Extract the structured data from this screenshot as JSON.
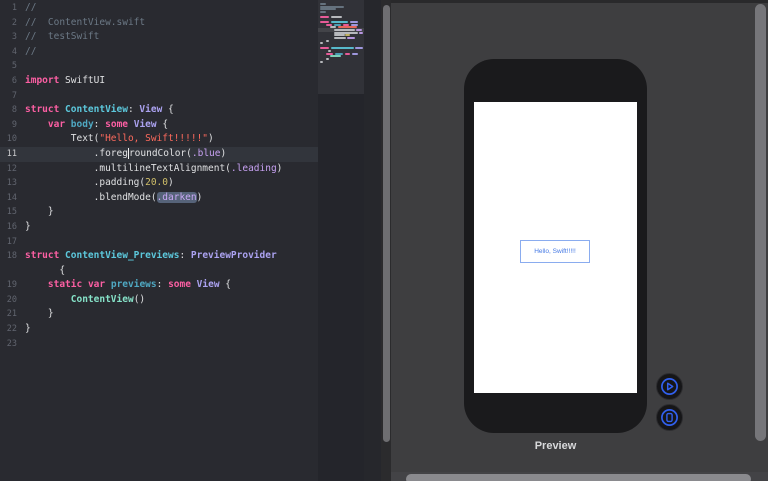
{
  "colors": {
    "editor_bg": "#292A30",
    "canvas_bg": "#3E3E40",
    "line_highlight": "#32353C",
    "selection_bg": "#566379",
    "keyword": "#FC5FA3",
    "string": "#FC6A5D",
    "number": "#D0BF69",
    "comment": "#6C7986",
    "plain": "#DFE0E2",
    "type_declaration": "#5CC8DC",
    "type_reference": "#ABA2F0",
    "property_declaration": "#4FA8C2",
    "member_reference": "#C7A1F2",
    "project_type": "#86E2C8",
    "accent_blue": "#3160EE",
    "preview_text_blue": "#4579E4",
    "preview_box_border": "#8AACEF"
  },
  "editor": {
    "current_line": "11",
    "lines": [
      {
        "n": "1",
        "seg": [
          [
            "cm",
            "//"
          ]
        ]
      },
      {
        "n": "2",
        "seg": [
          [
            "cm",
            "//  ContentView.swift"
          ]
        ]
      },
      {
        "n": "3",
        "seg": [
          [
            "cm",
            "//  testSwift"
          ]
        ]
      },
      {
        "n": "4",
        "seg": [
          [
            "cm",
            "//"
          ]
        ]
      },
      {
        "n": "5",
        "seg": []
      },
      {
        "n": "6",
        "seg": [
          [
            "kw",
            "import"
          ],
          [
            "pl",
            " SwiftUI"
          ]
        ]
      },
      {
        "n": "7",
        "seg": []
      },
      {
        "n": "8",
        "seg": [
          [
            "kw",
            "struct"
          ],
          [
            "tyd",
            " ContentView"
          ],
          [
            "pl",
            ": "
          ],
          [
            "tyr",
            "View"
          ],
          [
            "pl",
            " {"
          ]
        ]
      },
      {
        "n": "9",
        "seg": [
          [
            "pl",
            "    "
          ],
          [
            "kw",
            "var"
          ],
          [
            "prop",
            " body"
          ],
          [
            "pl",
            ": "
          ],
          [
            "kw",
            "some"
          ],
          [
            "tyr",
            " View"
          ],
          [
            "pl",
            " {"
          ]
        ]
      },
      {
        "n": "10",
        "seg": [
          [
            "pl",
            "        Text("
          ],
          [
            "str",
            "\"Hello, Swift!!!!!\""
          ],
          [
            "pl",
            ")"
          ]
        ]
      },
      {
        "n": "11",
        "hl": true,
        "seg": [
          [
            "pl",
            "            .foreg"
          ],
          [
            "caret",
            ""
          ],
          [
            "pl",
            "roundColor("
          ],
          [
            "mem",
            ".blue"
          ],
          [
            "pl",
            ")"
          ]
        ]
      },
      {
        "n": "12",
        "seg": [
          [
            "pl",
            "            .multilineTextAlignment("
          ],
          [
            "mem",
            ".leading"
          ],
          [
            "pl",
            ")"
          ]
        ]
      },
      {
        "n": "13",
        "seg": [
          [
            "pl",
            "            .padding("
          ],
          [
            "num",
            "20.0"
          ],
          [
            "pl",
            ")"
          ]
        ]
      },
      {
        "n": "14",
        "seg": [
          [
            "pl",
            "            .blendMode("
          ],
          [
            "memsel",
            ".darken"
          ],
          [
            "pl",
            ")"
          ]
        ]
      },
      {
        "n": "15",
        "seg": [
          [
            "pl",
            "    }"
          ]
        ]
      },
      {
        "n": "16",
        "seg": [
          [
            "pl",
            "}"
          ]
        ]
      },
      {
        "n": "17",
        "seg": []
      },
      {
        "n": "18",
        "seg": [
          [
            "kw",
            "struct"
          ],
          [
            "tyd",
            " ContentView_Previews"
          ],
          [
            "pl",
            ": "
          ],
          [
            "tyr",
            "PreviewProvider"
          ]
        ]
      },
      {
        "n": "",
        "seg": [
          [
            "pl",
            "      {"
          ]
        ]
      },
      {
        "n": "19",
        "seg": [
          [
            "pl",
            "    "
          ],
          [
            "kw",
            "static"
          ],
          [
            "pl",
            " "
          ],
          [
            "kw",
            "var"
          ],
          [
            "prop",
            " previews"
          ],
          [
            "pl",
            ": "
          ],
          [
            "kw",
            "some"
          ],
          [
            "tyr",
            " View"
          ],
          [
            "pl",
            " {"
          ]
        ]
      },
      {
        "n": "20",
        "seg": [
          [
            "pl",
            "        "
          ],
          [
            "proj",
            "ContentView"
          ],
          [
            "pl",
            "()"
          ]
        ]
      },
      {
        "n": "21",
        "seg": [
          [
            "pl",
            "    }"
          ]
        ]
      },
      {
        "n": "22",
        "seg": [
          [
            "pl",
            "}"
          ]
        ]
      },
      {
        "n": "23",
        "seg": []
      }
    ]
  },
  "minimap": {
    "rows": [
      {
        "y": 3,
        "bars": [
          [
            "cm",
            2,
            6
          ]
        ]
      },
      {
        "y": 6,
        "bars": [
          [
            "cm",
            2,
            24
          ]
        ]
      },
      {
        "y": 8,
        "bars": [
          [
            "cm",
            2,
            16
          ]
        ]
      },
      {
        "y": 11,
        "bars": [
          [
            "cm",
            2,
            6
          ]
        ]
      },
      {
        "y": 16,
        "bars": [
          [
            "kw",
            2,
            9
          ],
          [
            "pl",
            13,
            11
          ]
        ]
      },
      {
        "y": 21,
        "bars": [
          [
            "kw",
            2,
            9
          ],
          [
            "tyd",
            13,
            17
          ],
          [
            "tyr",
            32,
            8
          ]
        ]
      },
      {
        "y": 24,
        "bars": [
          [
            "kw",
            8,
            6
          ],
          [
            "prop",
            16,
            7
          ],
          [
            "kw",
            25,
            6
          ],
          [
            "tyr",
            33,
            7
          ]
        ]
      },
      {
        "y": 26,
        "bars": [
          [
            "pl",
            12,
            6
          ],
          [
            "str",
            20,
            19
          ]
        ]
      },
      {
        "y": 29,
        "bars": [
          [
            "pl",
            16,
            21
          ],
          [
            "mem",
            38,
            6
          ]
        ]
      },
      {
        "y": 32,
        "bars": [
          [
            "pl",
            16,
            24
          ],
          [
            "mem",
            41,
            4
          ]
        ]
      },
      {
        "y": 34,
        "bars": [
          [
            "pl",
            16,
            11
          ],
          [
            "num",
            27,
            5
          ]
        ]
      },
      {
        "y": 37,
        "bars": [
          [
            "pl",
            16,
            12
          ],
          [
            "mem",
            29,
            8
          ]
        ]
      },
      {
        "y": 40,
        "bars": [
          [
            "pl",
            8,
            3
          ]
        ]
      },
      {
        "y": 42,
        "bars": [
          [
            "pl",
            2,
            3
          ]
        ]
      },
      {
        "y": 47,
        "bars": [
          [
            "kw",
            2,
            9
          ],
          [
            "tyd",
            13,
            23
          ],
          [
            "tyr",
            37,
            8
          ]
        ]
      },
      {
        "y": 50,
        "bars": [
          [
            "pl",
            10,
            3
          ]
        ]
      },
      {
        "y": 53,
        "bars": [
          [
            "kw",
            8,
            7
          ],
          [
            "prop",
            17,
            8
          ],
          [
            "kw",
            27,
            5
          ],
          [
            "tyr",
            34,
            6
          ]
        ]
      },
      {
        "y": 55,
        "bars": [
          [
            "proj",
            12,
            11
          ]
        ]
      },
      {
        "y": 58,
        "bars": [
          [
            "pl",
            8,
            3
          ]
        ]
      },
      {
        "y": 61,
        "bars": [
          [
            "pl",
            2,
            3
          ]
        ]
      }
    ]
  },
  "preview": {
    "hello_text": "Hello, Swift!!!!!",
    "label": "Preview"
  },
  "icons": {
    "live_preview": "play-icon",
    "device_preview": "device-icon"
  }
}
